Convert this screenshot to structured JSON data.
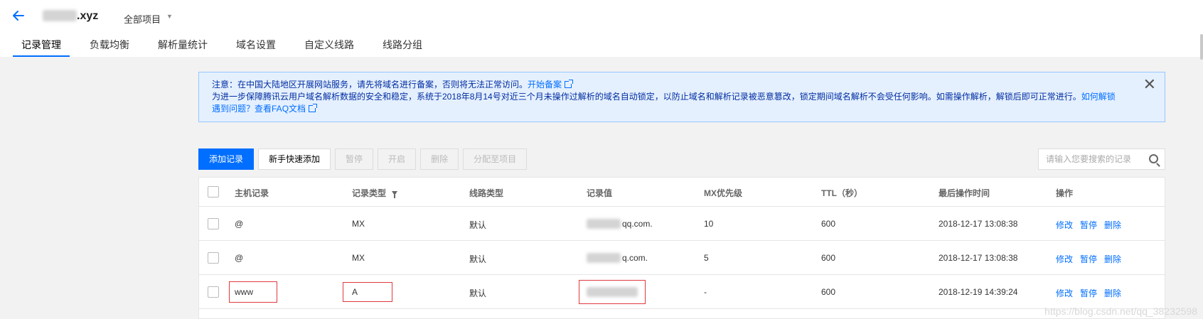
{
  "header": {
    "domain": ".xyz",
    "project": "全部项目"
  },
  "tabs": [
    {
      "label": "记录管理",
      "active": true
    },
    {
      "label": "负载均衡"
    },
    {
      "label": "解析量统计"
    },
    {
      "label": "域名设置"
    },
    {
      "label": "自定义线路"
    },
    {
      "label": "线路分组"
    }
  ],
  "notice": {
    "line1": "注意：在中国大陆地区开展网站服务，请先将域名进行备案，否则将无法正常访问。",
    "line1_link": "开始备案",
    "line2": "为进一步保障腾讯云用户域名解析数据的安全和稳定，系统于2018年8月14号对近三个月未操作过解析的域名自动锁定，以防止域名和解析记录被恶意篡改，锁定期间域名解析不会受任何影响。如需操作解析，解锁后即可正常进行。",
    "line2_link": "如何解锁",
    "line3": "遇到问题？",
    "line3_link": "查看FAQ文档"
  },
  "toolbar": {
    "add": "添加记录",
    "quick_add": "新手快速添加",
    "pause": "暂停",
    "enable": "开启",
    "delete": "删除",
    "assign": "分配至项目"
  },
  "search": {
    "placeholder": "请输入您要搜索的记录"
  },
  "table": {
    "columns": [
      "主机记录",
      "记录类型",
      "线路类型",
      "记录值",
      "MX优先级",
      "TTL（秒）",
      "最后操作时间",
      "操作"
    ],
    "rows": [
      {
        "host": "@",
        "type": "MX",
        "line": "默认",
        "value": "qq.com.",
        "mx": "10",
        "ttl": "600",
        "time": "2018-12-17 13:08:38"
      },
      {
        "host": "@",
        "type": "MX",
        "line": "默认",
        "value": "q.com.",
        "mx": "5",
        "ttl": "600",
        "time": "2018-12-17 13:08:38"
      },
      {
        "host": "www",
        "type": "A",
        "line": "默认",
        "value": "",
        "mx": "-",
        "ttl": "600",
        "time": "2018-12-19 14:39:24"
      }
    ],
    "actions": {
      "edit": "修改",
      "pause": "暂停",
      "delete": "删除"
    }
  },
  "watermark": "https://blog.csdn.net/qq_38232598"
}
